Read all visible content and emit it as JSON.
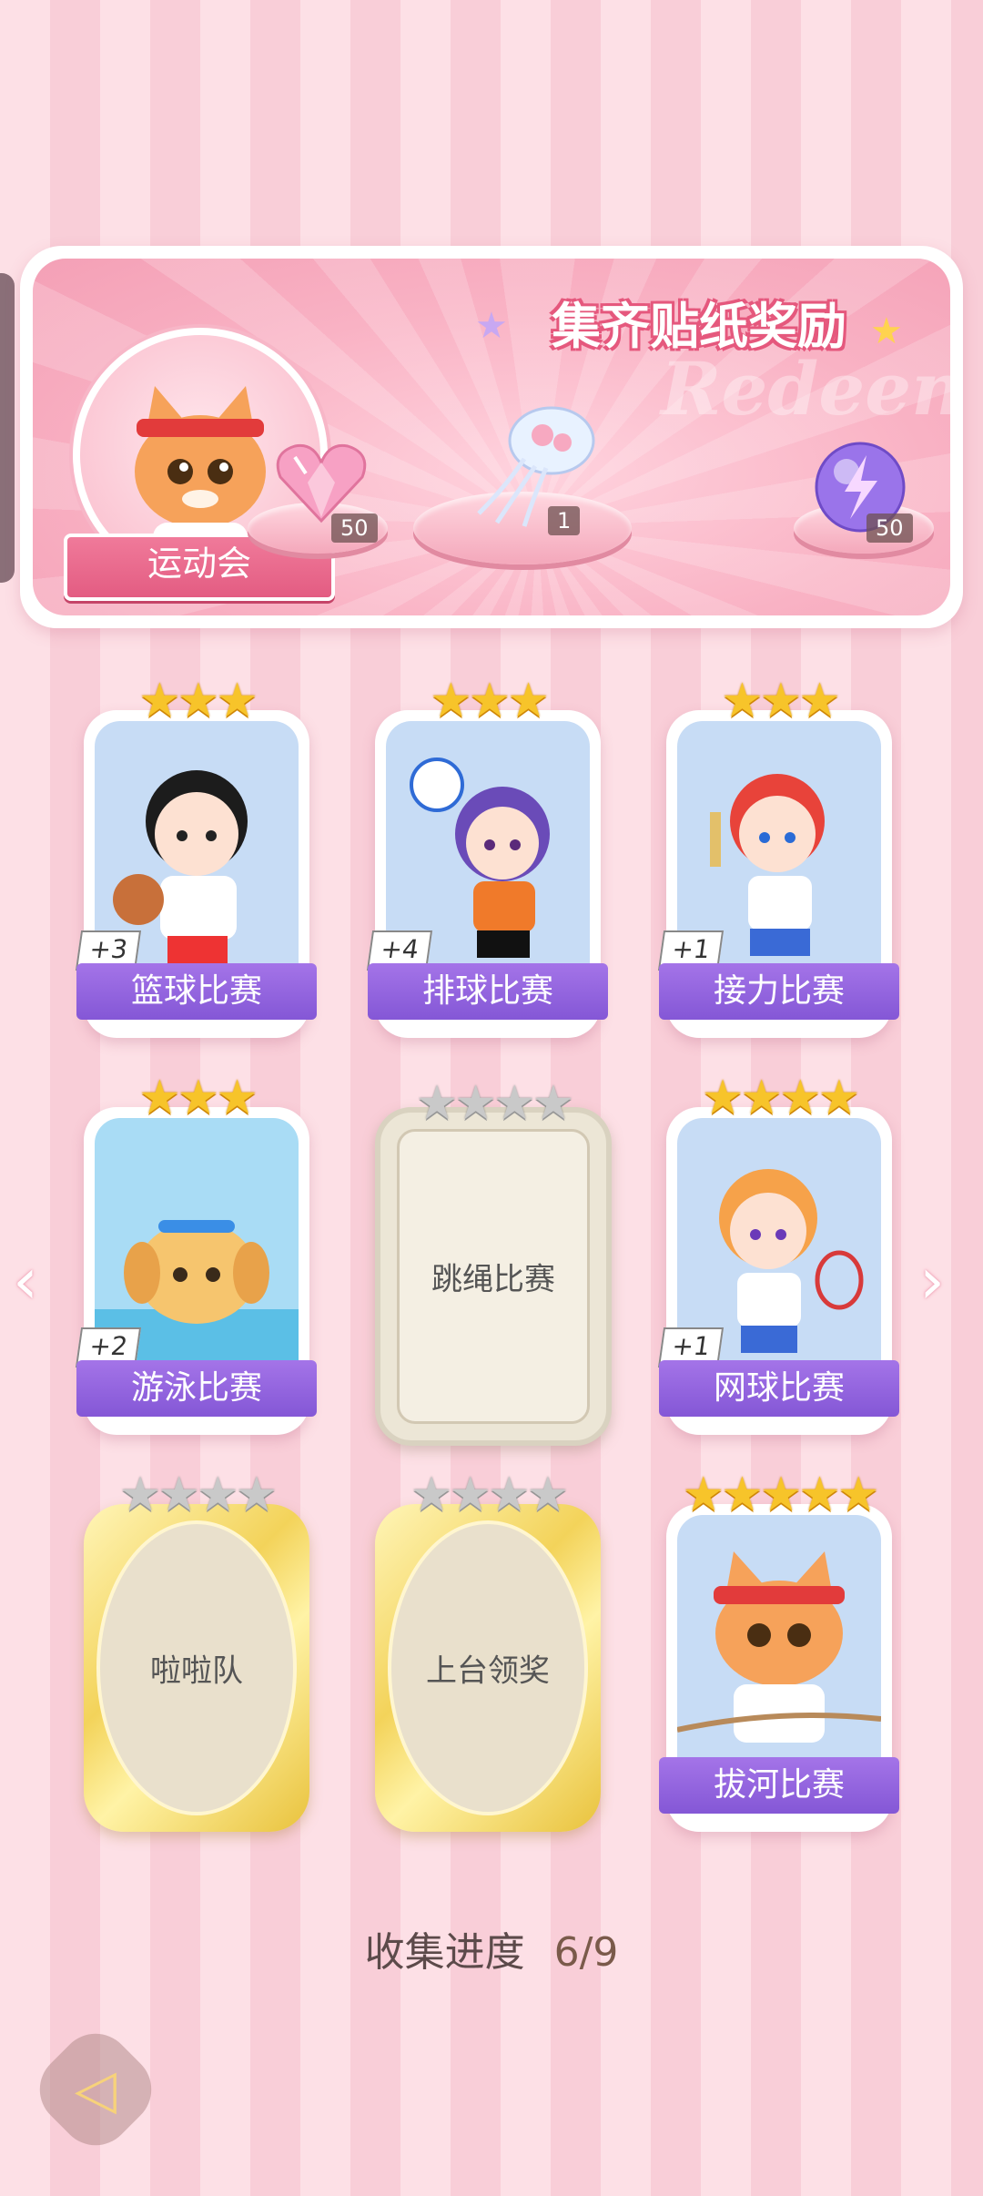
{
  "banner": {
    "title": "集齐贴纸奖励",
    "watermark": "Redeem",
    "album_label": "运动会",
    "rewards": [
      {
        "icon": "heart-gem-icon",
        "count": "50"
      },
      {
        "icon": "jellyfish-bouquet-icon",
        "count": "1"
      },
      {
        "icon": "lightning-orb-icon",
        "count": "50"
      }
    ]
  },
  "cards": [
    {
      "label": "篮球比赛",
      "stars": 3,
      "max_stars": 3,
      "plus": "+3",
      "state": "collected"
    },
    {
      "label": "排球比赛",
      "stars": 3,
      "max_stars": 3,
      "plus": "+4",
      "state": "collected"
    },
    {
      "label": "接力比赛",
      "stars": 3,
      "max_stars": 3,
      "plus": "+1",
      "state": "collected"
    },
    {
      "label": "游泳比赛",
      "stars": 3,
      "max_stars": 3,
      "plus": "+2",
      "state": "collected"
    },
    {
      "label": "跳绳比赛",
      "stars": 0,
      "max_stars": 4,
      "plus": "",
      "state": "locked"
    },
    {
      "label": "网球比赛",
      "stars": 4,
      "max_stars": 4,
      "plus": "+1",
      "state": "collected"
    },
    {
      "label": "啦啦队",
      "stars": 0,
      "max_stars": 4,
      "plus": "",
      "state": "locked-gold"
    },
    {
      "label": "上台领奖",
      "stars": 0,
      "max_stars": 4,
      "plus": "",
      "state": "locked-gold"
    },
    {
      "label": "拔河比赛",
      "stars": 5,
      "max_stars": 5,
      "plus": "",
      "state": "collected"
    }
  ],
  "progress": {
    "label": "收集进度",
    "value": "6/9"
  },
  "colors": {
    "accent_purple": "#8457d6",
    "star_gold": "#f7c42a",
    "pink_bg": "#fde0e6"
  }
}
